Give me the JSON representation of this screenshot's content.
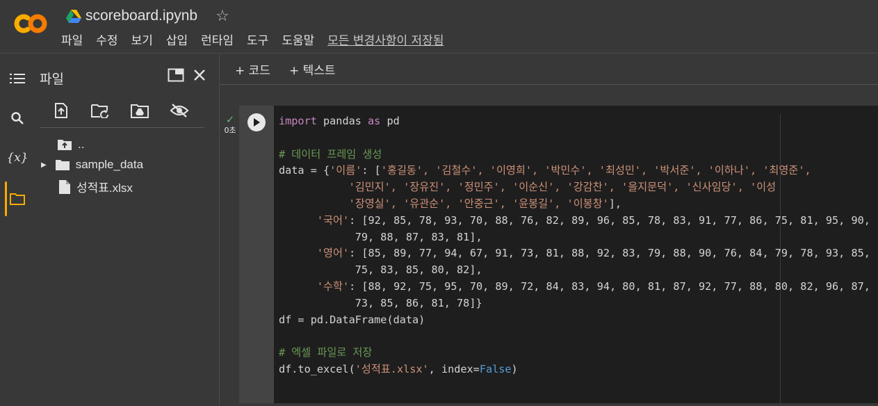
{
  "app": {
    "notebook_title": "scoreboard.ipynb",
    "menu": [
      "파일",
      "수정",
      "보기",
      "삽입",
      "런타임",
      "도구",
      "도움말"
    ],
    "save_status": "모든 변경사항이 저장됨"
  },
  "file_panel": {
    "title": "파일",
    "tree": [
      {
        "label": "..",
        "type": "parent-folder"
      },
      {
        "label": "sample_data",
        "type": "folder"
      },
      {
        "label": "성적표.xlsx",
        "type": "file"
      }
    ]
  },
  "toolbar": {
    "add_code": "+ 코드",
    "add_text": "+ 텍스트"
  },
  "cell": {
    "exec_time": "0초",
    "status_icon": "check-icon",
    "code": {
      "import_kw": "import",
      "import_mod": " pandas ",
      "as_kw": "as",
      "alias": " pd",
      "comment1": "# 데이터 프레임 생성",
      "data_open": "data = {",
      "key_name": "'이름'",
      "name_line1_pre": ": [",
      "names1": "'홍길동', '김철수', '이영희', '박민수', '최성민', '박서준', '이하나', '최영준',",
      "names2": "'김민지', '장유진', '정민주', '이순신', '강감찬', '을지문덕', '신사임당', '이성",
      "names3": "'장영실', '유관순', '안중근', '윤봉길', '이봉창'",
      "names3_post": "],",
      "key_kor": "'국어'",
      "kor1": ": [92, 85, 78, 93, 70, 88, 76, 82, 89, 96, 85, 78, 83, 91, 77, 86, 75, 81, 95, 90,",
      "kor2": "79, 88, 87, 83, 81],",
      "key_eng": "'영어'",
      "eng1": ": [85, 89, 77, 94, 67, 91, 73, 81, 88, 92, 83, 79, 88, 90, 76, 84, 79, 78, 93, 85,",
      "eng2": "75, 83, 85, 80, 82],",
      "key_math": "'수학'",
      "math1": ": [88, 92, 75, 95, 70, 89, 72, 84, 83, 94, 80, 81, 87, 92, 77, 88, 80, 82, 96, 87,",
      "math2": "73, 85, 86, 81, 78]}",
      "df_line": "df = pd.DataFrame(data)",
      "comment2": "# 엑셀 파일로 저장",
      "excel_pre": "df.to_excel(",
      "excel_file": "'성적표.xlsx'",
      "excel_mid": ", index=",
      "excel_false": "False",
      "excel_post": ")"
    }
  },
  "colors": {
    "keyword": "#c586c0",
    "comment": "#6a9955",
    "string": "#ce9178",
    "boolean": "#569cd6",
    "accent": "#f9ab00"
  }
}
